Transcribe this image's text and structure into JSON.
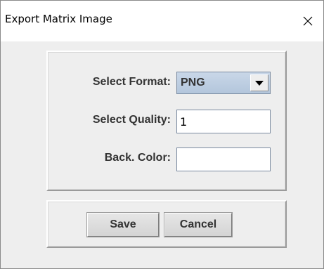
{
  "window": {
    "title": "Export Matrix Image",
    "close_icon": "close-x-icon"
  },
  "form": {
    "format_label": "Select Format:",
    "format_value": "PNG",
    "format_arrow_icon": "triangle-down-icon",
    "quality_label": "Select Quality:",
    "quality_value": "1",
    "color_label": "Back. Color:",
    "color_value": ""
  },
  "buttons": {
    "save_label": "Save",
    "cancel_label": "Cancel"
  },
  "colors": {
    "combo_bg": "#b9cbe0",
    "panel_bg": "#eeeeee",
    "label_text": "#333333"
  }
}
